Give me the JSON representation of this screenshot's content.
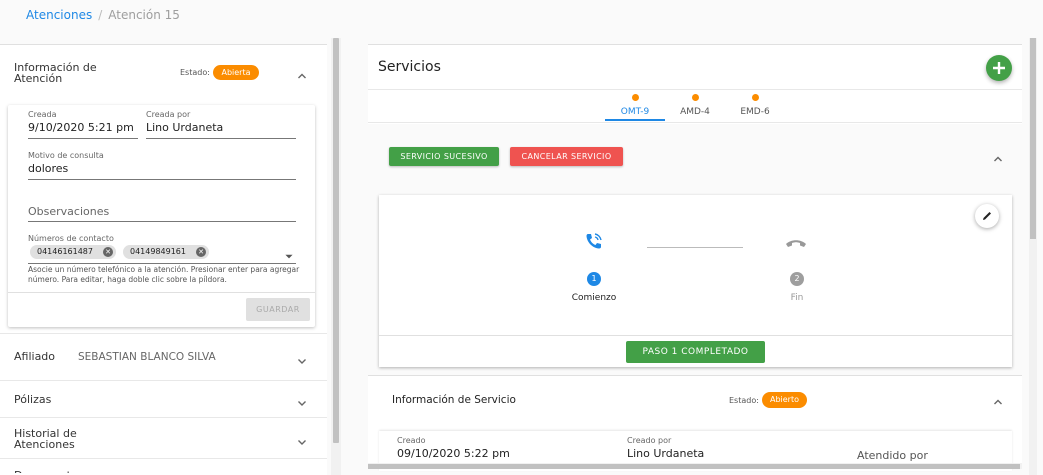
{
  "breadcrumb": {
    "root": "Atenciones",
    "current": "Atención 15"
  },
  "left": {
    "info_title": "Información de\nAtención",
    "estado_label": "Estado:",
    "estado_value": "Abierta",
    "fields": {
      "creada_label": "Creada",
      "creada_value": "9/10/2020 5:21 pm",
      "creada_por_label": "Creada por",
      "creada_por_value": "Lino Urdaneta",
      "motivo_label": "Motivo de consulta",
      "motivo_value": "dolores",
      "observaciones_placeholder": "Observaciones",
      "numeros_label": "Números de contacto",
      "chips": [
        "04146161487",
        "04149849161"
      ],
      "hint": "Asocie un número telefónico a la atención. Presionar enter para agregar número. Para editar, haga doble clic sobre la píldora."
    },
    "guardar_label": "GUARDAR",
    "afiliado_label": "Afiliado",
    "afiliado_value": "SEBASTIAN BLANCO SILVA",
    "polizas_label": "Pólizas",
    "historial_label": "Historial de\nAtenciones",
    "cut_label": "Document"
  },
  "right": {
    "title": "Servicios",
    "tabs": [
      {
        "label": "OMT-9",
        "active": true
      },
      {
        "label": "AMD-4",
        "active": false
      },
      {
        "label": "EMD-6",
        "active": false
      }
    ],
    "btn_sucesivo": "SERVICIO SUCESIVO",
    "btn_cancelar": "CANCELAR SERVICIO",
    "steps": [
      {
        "num": "1",
        "label": "Comienzo",
        "active": true
      },
      {
        "num": "2",
        "label": "Fin",
        "active": false
      }
    ],
    "paso_label": "PASO 1 COMPLETADO",
    "info_servicio_title": "Información de Servicio",
    "estado_label": "Estado:",
    "estado_value": "Abierto",
    "info": {
      "creado_label": "Creado",
      "creado_value": "09/10/2020 5:22 pm",
      "creado_por_label": "Creado por",
      "creado_por_value": "Lino Urdaneta",
      "atendido_label": "Atendido por"
    }
  },
  "colors": {
    "accent": "#1e88e5",
    "warning": "#fb8c00",
    "success": "#43a047",
    "danger": "#ef5350"
  }
}
